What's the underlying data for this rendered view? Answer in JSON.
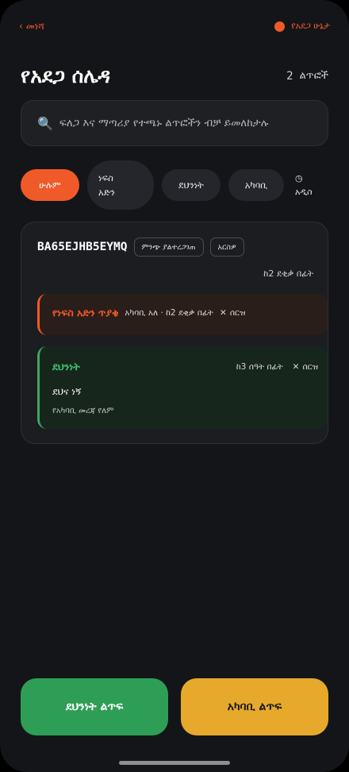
{
  "topbar": {
    "back_label": "መነሻ",
    "status_label": "የአደጋ ሁኔታ",
    "status_color": "#f05a28"
  },
  "header": {
    "title": "የአደጋ ሰሌዳ",
    "count_value": "2",
    "count_unit": "ልጥፎች"
  },
  "search": {
    "placeholder": "ፍለጋ እና ማጣሪያ የተጫኑ ልጥፎችን ብቻ ይመለከታሉ"
  },
  "filters": [
    {
      "label": "ሁሉም",
      "active": true
    },
    {
      "label_line1": "ነፍስ",
      "label_line2": "አድን"
    },
    {
      "label": "ደህንነት"
    },
    {
      "label": "አካባቢ"
    }
  ],
  "sort": {
    "icon": "clock-icon",
    "label": "አዲስ"
  },
  "post": {
    "code": "BA65EJHB5EYMQ",
    "badge_unverified": "ምንጭ ያልተረጋገጠ",
    "badge_archive": "አርስዎ",
    "time_value": "ከ2",
    "time_rest": "ደቂቃ በፊት",
    "alerts": {
      "rescue": {
        "label": "የነፍስ አድን ጥያቄ",
        "detail": "አካባቢ አለ · ከ2 ደቂቃ በፊት",
        "delete_label": "ሰርዝ",
        "color": "#f05a28"
      },
      "safety": {
        "label": "ደህንነት",
        "time": "ከ3 ሰዓት በፊት",
        "delete_label": "ሰርዝ",
        "message": "ደህና ነኝ",
        "location": "የአካባቢ መረጃ የለም",
        "color": "#3aa862"
      }
    }
  },
  "actions": {
    "safety_button": "ደህንነት ልጥፍ",
    "area_button": "አካባቢ ልጥፍ",
    "safety_color": "#2e9e56",
    "area_color": "#e6a92b"
  }
}
